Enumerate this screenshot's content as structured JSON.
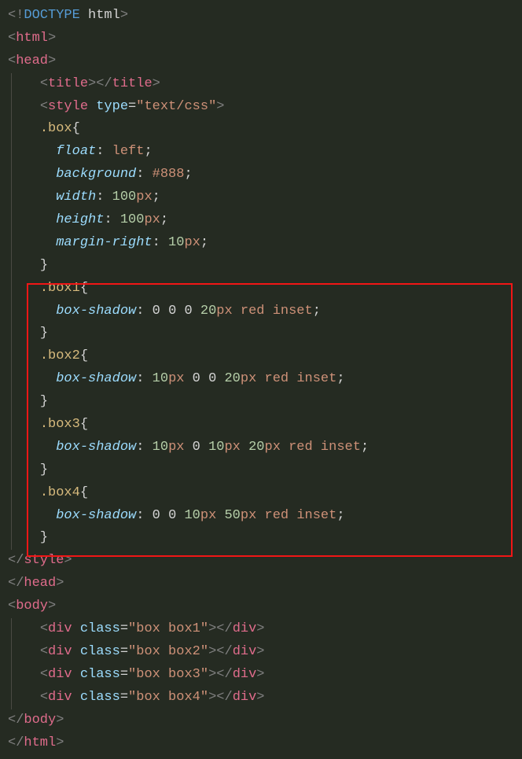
{
  "doctype": {
    "bang": "<!",
    "word": "DOCTYPE",
    "arg": "html",
    "close": ">"
  },
  "tags": {
    "html_open": "html",
    "html_close": "html",
    "head_open": "head",
    "head_close": "head",
    "title_open": "title",
    "title_close": "title",
    "style_open": "style",
    "style_close": "style",
    "body_open": "body",
    "body_close": "body",
    "div": "div"
  },
  "style_attr": {
    "name": "type",
    "value": "\"text/css\""
  },
  "css": {
    "box": {
      "selector": ".box",
      "rules": [
        {
          "prop": "float",
          "value_text": "left"
        },
        {
          "prop": "background",
          "value_text": "#888"
        },
        {
          "prop": "width",
          "value_num": "100",
          "value_unit": "px"
        },
        {
          "prop": "height",
          "value_num": "100",
          "value_unit": "px"
        },
        {
          "prop": "margin-right",
          "value_num": "10",
          "value_unit": "px"
        }
      ]
    },
    "box1": {
      "selector": ".box1",
      "prop": "box-shadow",
      "parts": [
        "0",
        "0",
        "0",
        "20px",
        "red",
        "inset"
      ]
    },
    "box2": {
      "selector": ".box2",
      "prop": "box-shadow",
      "parts": [
        "10px",
        "0",
        "0",
        "20px",
        "red",
        "inset"
      ]
    },
    "box3": {
      "selector": ".box3",
      "prop": "box-shadow",
      "parts": [
        "10px",
        "0",
        "10px",
        "20px",
        "red",
        "inset"
      ]
    },
    "box4": {
      "selector": ".box4",
      "prop": "box-shadow",
      "parts": [
        "0",
        "0",
        "10px",
        "50px",
        "red",
        "inset"
      ]
    }
  },
  "divs": [
    {
      "class_attr": "\"box box1\""
    },
    {
      "class_attr": "\"box box2\""
    },
    {
      "class_attr": "\"box box3\""
    },
    {
      "class_attr": "\"box box4\""
    }
  ],
  "labels": {
    "class": "class"
  }
}
